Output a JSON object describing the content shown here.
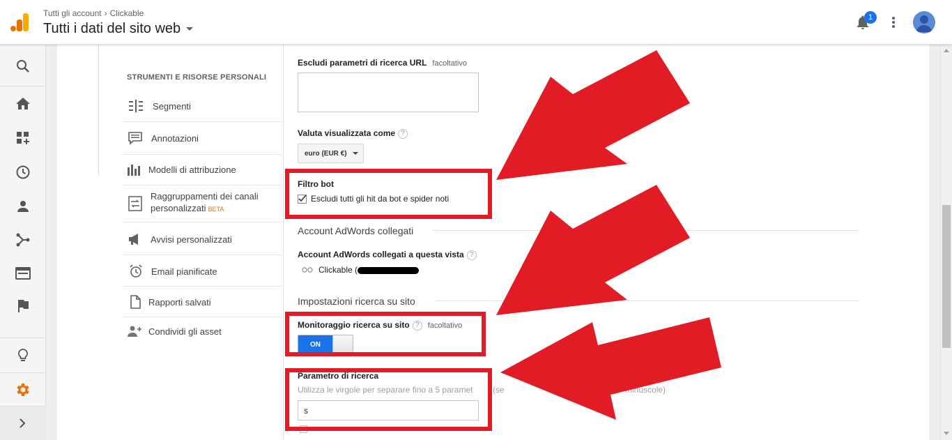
{
  "header": {
    "breadcrumb": [
      "Tutti gli account",
      "Clickable"
    ],
    "property_title": "Tutti i dati del sito web",
    "notification_count": "1"
  },
  "leftnav": {
    "icons": [
      "search-icon",
      "home-icon",
      "customization-icon",
      "realtime-icon",
      "audience-icon",
      "acquisition-icon",
      "behavior-icon",
      "conversions-icon",
      "discover-icon",
      "admin-gear-icon",
      "expand-icon"
    ]
  },
  "menu": {
    "section_title": "STRUMENTI E RISORSE PERSONALI",
    "items": [
      {
        "label": "Segmenti",
        "icon": "segments-icon"
      },
      {
        "label": "Annotazioni",
        "icon": "annotations-icon"
      },
      {
        "label": "Modelli di attribuzione",
        "icon": "attribution-icon"
      },
      {
        "label": "Raggruppamenti dei canali",
        "label2": "personalizzati",
        "badge": "BETA",
        "icon": "channel-grouping-icon"
      },
      {
        "label": "Avvisi personalizzati",
        "icon": "megaphone-icon"
      },
      {
        "label": "Email pianificate",
        "icon": "alarm-clock-icon"
      },
      {
        "label": "Rapporti salvati",
        "icon": "saved-report-icon"
      },
      {
        "label": "Condividi gli asset",
        "icon": "share-user-icon"
      }
    ]
  },
  "settings": {
    "exclude_params": {
      "label": "Escludi parametri di ricerca URL",
      "optional": "facoltativo",
      "value": ""
    },
    "currency": {
      "label": "Valuta visualizzata come",
      "help": "?",
      "value": "euro (EUR €)"
    },
    "bot_filter": {
      "label": "Filtro bot",
      "checkbox_label": "Escludi tutti gli hit da bot e spider noti",
      "checked": true
    },
    "adwords_heading": "Account AdWords collegati",
    "adwords_linked": {
      "label": "Account AdWords collegati a questa vista",
      "help": "?",
      "account": "Clickable ("
    },
    "site_search_heading": "Impostazioni ricerca su sito",
    "site_search": {
      "label": "Monitoraggio ricerca su sito",
      "help": "?",
      "optional": "facoltativo",
      "toggle": "ON"
    },
    "search_param": {
      "label": "Parametro di ricerca",
      "hint_left": "Utilizza le virgole per separare fino a 5 paramet",
      "hint_mid": "(se",
      "hint_right": "minuscole)",
      "value": "s"
    }
  },
  "colors": {
    "accent": "#1a73e8",
    "annotation_red": "#e11c24",
    "admin_orange": "#e8710a",
    "logo_orange": "#f9ab00",
    "logo_dark": "#e37400"
  }
}
